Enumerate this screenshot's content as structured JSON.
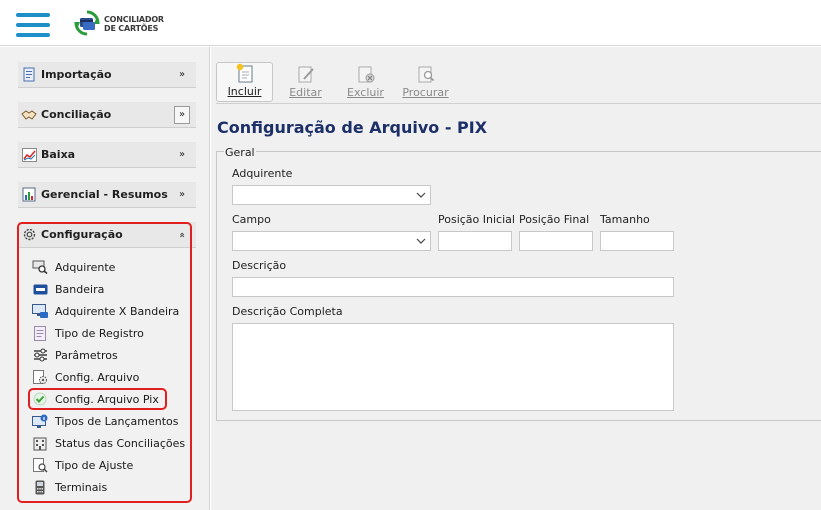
{
  "header": {
    "logo_line1": "CONCILIADOR",
    "logo_line2": "DE CARTÕES",
    "brand_color": "#1e8fc8"
  },
  "sidebar": {
    "groups": [
      {
        "label": "Importação",
        "icon": "import-icon",
        "chevron": "chevron-down-double"
      },
      {
        "label": "Conciliação",
        "icon": "handshake-icon",
        "chevron": "chevron-down-double"
      },
      {
        "label": "Baixa",
        "icon": "chart-line-icon",
        "chevron": "chevron-down-double"
      },
      {
        "label": "Gerencial - Resumos",
        "icon": "report-icon",
        "chevron": "chevron-down-double"
      },
      {
        "label": "Configuração",
        "icon": "gear-icon",
        "chevron": "chevron-up-double"
      }
    ],
    "config_items": [
      {
        "label": "Adquirente",
        "icon": "search-card-icon"
      },
      {
        "label": "Bandeira",
        "icon": "card-brand-icon"
      },
      {
        "label": "Adquirente X Bandeira",
        "icon": "monitor-card-icon"
      },
      {
        "label": "Tipo de Registro",
        "icon": "document-icon"
      },
      {
        "label": "Parâmetros",
        "icon": "sliders-icon"
      },
      {
        "label": "Config. Arquivo",
        "icon": "file-gear-icon"
      },
      {
        "label": "Config. Arquivo Pix",
        "icon": "check-circle-icon"
      },
      {
        "label": "Tipos de Lançamentos",
        "icon": "monitor-info-icon"
      },
      {
        "label": "Status das Conciliações",
        "icon": "building-icon"
      },
      {
        "label": "Tipo de Ajuste",
        "icon": "file-search-icon"
      },
      {
        "label": "Terminais",
        "icon": "pos-terminal-icon"
      }
    ],
    "highlight_color": "#e02020"
  },
  "toolbar": {
    "buttons": [
      {
        "label": "Incluir",
        "icon": "new-document-icon",
        "enabled": true
      },
      {
        "label": "Editar",
        "icon": "edit-document-icon",
        "enabled": false
      },
      {
        "label": "Excluir",
        "icon": "delete-document-icon",
        "enabled": false
      },
      {
        "label": "Procurar",
        "icon": "search-document-icon",
        "enabled": false
      }
    ]
  },
  "page": {
    "title": "Configuração de Arquivo - PIX",
    "title_color": "#1c2f66"
  },
  "form": {
    "group_label": "Geral",
    "adquirente_label": "Adquirente",
    "adquirente_value": "",
    "campo_label": "Campo",
    "campo_value": "",
    "posicao_inicial_label": "Posição Inicial",
    "posicao_inicial_value": "",
    "posicao_final_label": "Posição Final",
    "posicao_final_value": "",
    "tamanho_label": "Tamanho",
    "tamanho_value": "",
    "descricao_label": "Descrição",
    "descricao_value": "",
    "descricao_completa_label": "Descrição Completa",
    "descricao_completa_value": ""
  }
}
